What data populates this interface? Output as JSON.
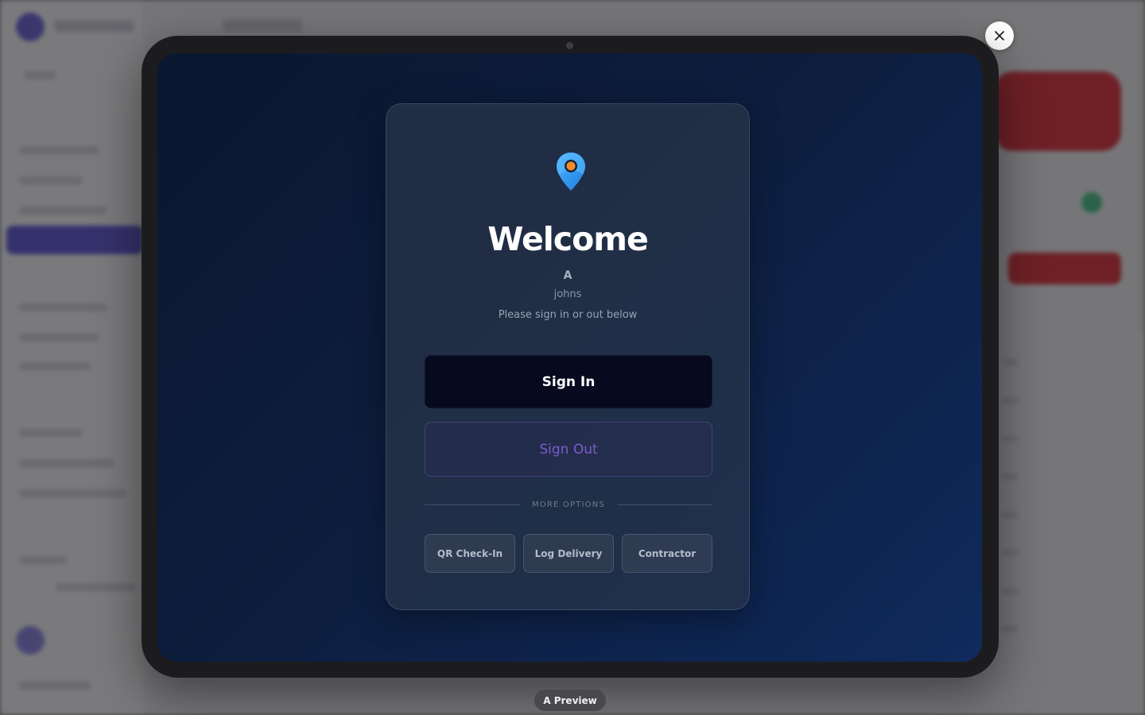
{
  "kiosk": {
    "welcome_title": "Welcome",
    "visitor_initial": "A",
    "visitor_username": "johns",
    "instruction": "Please sign in or out below",
    "sign_in_label": "Sign In",
    "sign_out_label": "Sign Out",
    "more_options_label": "MORE OPTIONS",
    "options": [
      {
        "label": "QR Check-In"
      },
      {
        "label": "Log Delivery"
      },
      {
        "label": "Contractor"
      }
    ]
  },
  "preview_badge": "A Preview",
  "icons": {
    "location_pin": "map-pin-icon",
    "close": "close-icon"
  },
  "colors": {
    "screen_background": "#0d1d3d",
    "sign_in_background": "#070a1f",
    "sign_out_text": "#7a5ccf",
    "pin_blue": "#3b9bff",
    "pin_center": "#f28c28"
  }
}
